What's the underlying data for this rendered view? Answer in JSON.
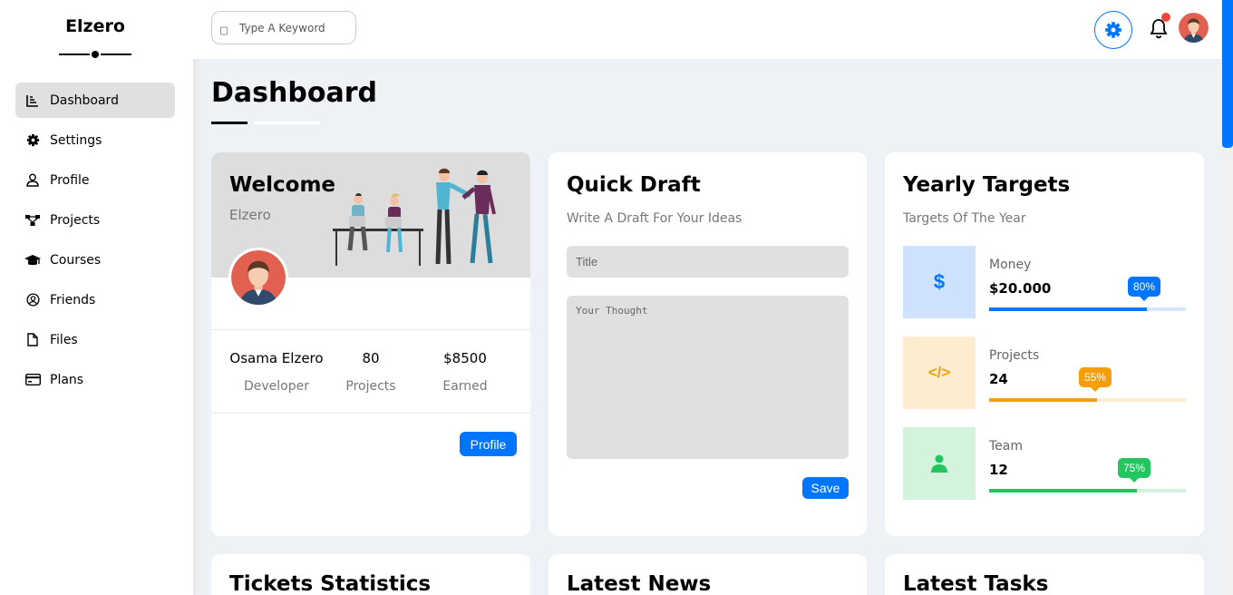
{
  "sidebar": {
    "logo": "Elzero",
    "items": [
      {
        "label": "Dashboard",
        "icon": "chart-icon",
        "active": true
      },
      {
        "label": "Settings",
        "icon": "gear-icon"
      },
      {
        "label": "Profile",
        "icon": "user-icon"
      },
      {
        "label": "Projects",
        "icon": "diagram-icon"
      },
      {
        "label": "Courses",
        "icon": "graduation-cap-icon"
      },
      {
        "label": "Friends",
        "icon": "user-circle-icon"
      },
      {
        "label": "Files",
        "icon": "file-icon"
      },
      {
        "label": "Plans",
        "icon": "credit-card-icon"
      }
    ]
  },
  "header": {
    "search_placeholder": "Type A Keyword"
  },
  "page": {
    "title": "Dashboard"
  },
  "welcome": {
    "title": "Welcome",
    "subtitle": "Elzero",
    "stats": [
      {
        "value": "Osama Elzero",
        "label": "Developer"
      },
      {
        "value": "80",
        "label": "Projects"
      },
      {
        "value": "$8500",
        "label": "Earned"
      }
    ],
    "button": "Profile"
  },
  "draft": {
    "title": "Quick Draft",
    "subtitle": "Write A Draft For Your Ideas",
    "title_placeholder": "Title",
    "body_placeholder": "Your Thought",
    "button": "Save"
  },
  "targets": {
    "title": "Yearly Targets",
    "subtitle": "Targets Of The Year",
    "items": [
      {
        "label": "Money",
        "value": "$20.000",
        "percent": "80%",
        "fill": 0.8,
        "color": "#0075ff",
        "track": "#d6e6fb",
        "bg": "#cfe2fd",
        "icon": "dollar-icon",
        "symbol": "$"
      },
      {
        "label": "Projects",
        "value": "24",
        "percent": "55%",
        "fill": 0.55,
        "color": "#f59e0b",
        "track": "#fdebd3",
        "bg": "#fdecd0",
        "icon": "code-icon",
        "symbol": "</>"
      },
      {
        "label": "Team",
        "value": "12",
        "percent": "75%",
        "fill": 0.75,
        "color": "#22c55e",
        "track": "#d4f1dd",
        "bg": "#d3f3dd",
        "icon": "user-icon"
      }
    ]
  },
  "bottom_cards": [
    "Tickets Statistics",
    "Latest News",
    "Latest Tasks"
  ]
}
